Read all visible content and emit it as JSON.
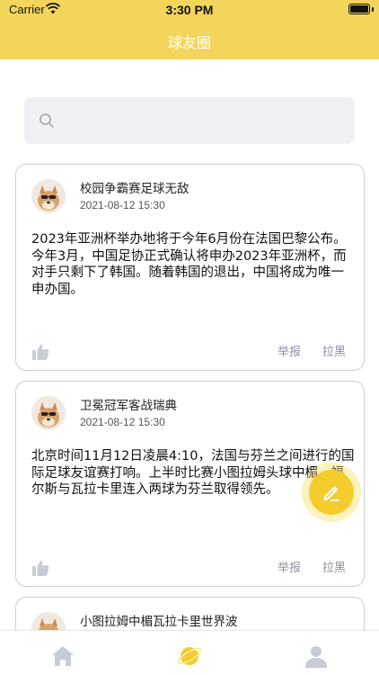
{
  "status_bar": {
    "carrier": "Carrier",
    "time": "3:30 PM"
  },
  "header": {
    "title": "球友圈"
  },
  "search": {
    "placeholder": ""
  },
  "posts": [
    {
      "title": "校园争霸赛足球无敌",
      "time": "2021-08-12 15:30",
      "content": "2023年亚洲杯举办地将于今年6月份在法国巴黎公布。今年3月，中国足协正式确认将申办2023年亚洲杯，而对手只剩下了韩国。随着韩国的退出，中国将成为唯一申办国。",
      "report_label": "举报",
      "block_label": "拉黑"
    },
    {
      "title": "卫冕冠军客战瑞典",
      "time": "2021-08-12 15:30",
      "content": "北京时间11月12日凌晨4:10，法国与芬兰之间进行的国际足球友谊赛打响。上半时比赛小图拉姆头球中楣，福尔斯与瓦拉卡里连入两球为芬兰取得领先。",
      "report_label": "举报",
      "block_label": "拉黑"
    },
    {
      "title": "小图拉姆中楣瓦拉卡里世界波",
      "time": "",
      "content": "",
      "report_label": "",
      "block_label": ""
    }
  ],
  "fab": {
    "icon": "edit-icon"
  },
  "tabbar": {
    "items": [
      {
        "icon": "home-icon",
        "active": false
      },
      {
        "icon": "planet-icon",
        "active": true
      },
      {
        "icon": "user-icon",
        "active": false
      }
    ]
  },
  "colors": {
    "accent": "#f3d55b",
    "tab_active": "#f4cc2c",
    "tab_inactive": "#c8ccd4"
  }
}
